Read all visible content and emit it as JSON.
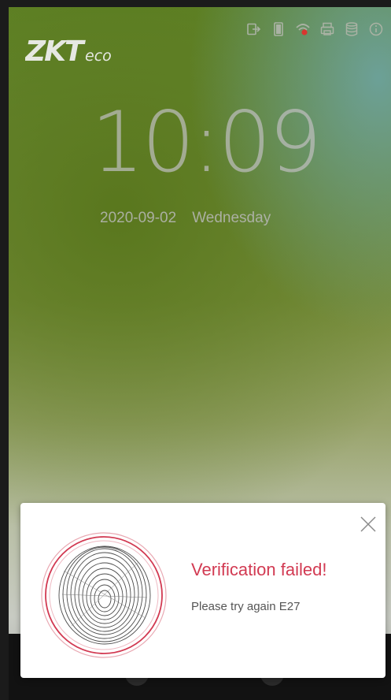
{
  "brand": {
    "logo_text": "ZKTeco"
  },
  "status_icons": [
    "exit-icon",
    "door-icon",
    "wifi-icon",
    "printer-icon",
    "database-icon",
    "info-icon"
  ],
  "clock": {
    "time": "10:09",
    "date": "2020-09-02",
    "weekday": "Wednesday"
  },
  "dialog": {
    "title": "Verification failed!",
    "message": "Please try again E27",
    "close_icon": "close-icon",
    "image_icon": "fingerprint-icon"
  },
  "colors": {
    "error": "#d23a52",
    "dialog_bg": "#ffffff",
    "wifi_alert": "#d9362f"
  }
}
